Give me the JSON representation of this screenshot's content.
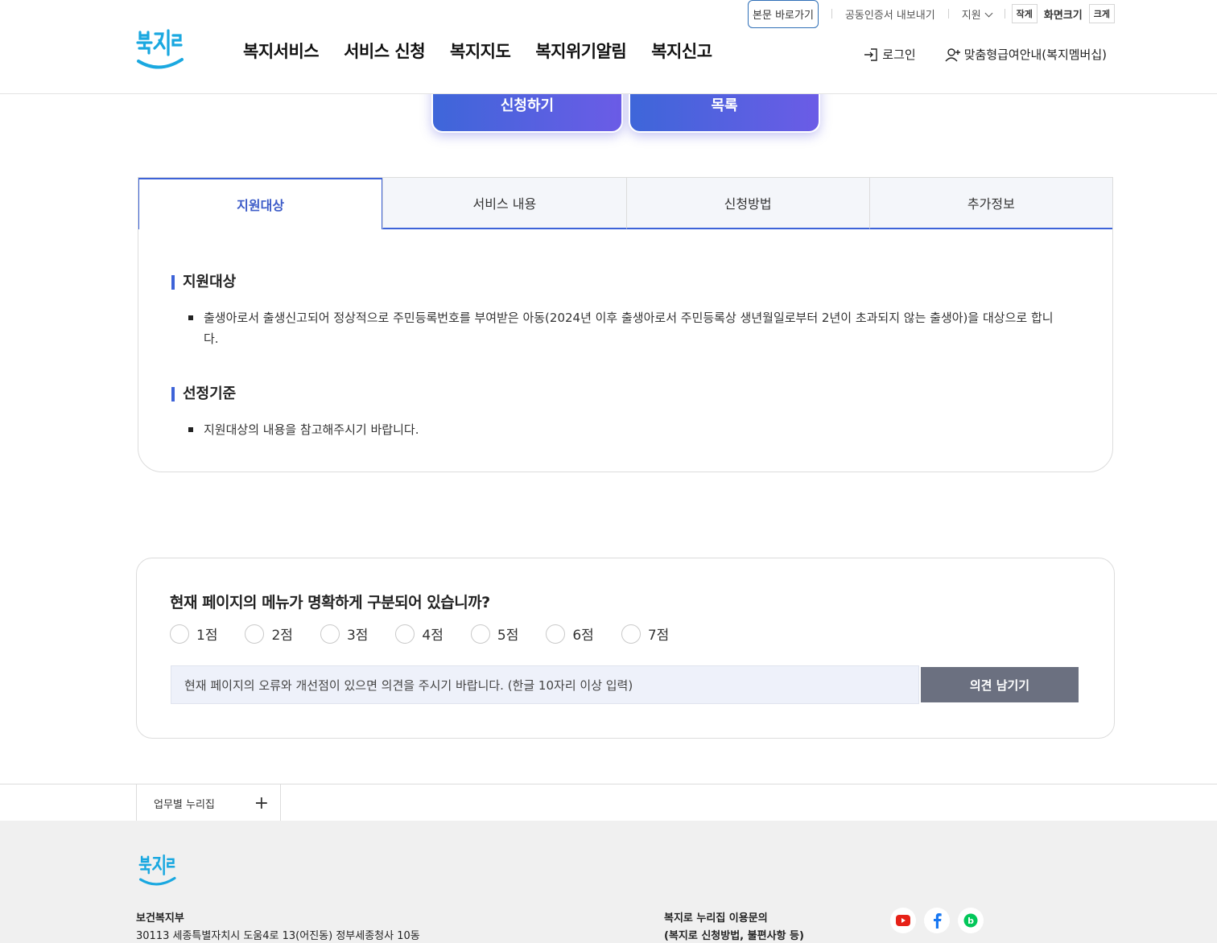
{
  "header": {
    "skip_link": "본문 바로가기",
    "util_links": [
      "공동인증서 내보내기",
      "지원"
    ],
    "font_small": "작게",
    "font_label": "화면크기",
    "font_large": "크게",
    "gnb": [
      "복지서비스",
      "서비스 신청",
      "복지지도",
      "복지위기알림",
      "복지신고"
    ],
    "login": "로그인",
    "membership": "맞춤형급여안내(복지멤버십)"
  },
  "actions": {
    "apply": "신청하기",
    "list": "목록"
  },
  "tabs": [
    "지원대상",
    "서비스 내용",
    "신청방법",
    "추가정보"
  ],
  "content": {
    "section1_title": "지원대상",
    "section1_text": "출생아로서 출생신고되어 정상적으로 주민등록번호를 부여받은 아동(2024년 이후 출생아로서 주민등록상 생년월일로부터 2년이 초과되지 않는 출생아)을 대상으로 합니다.",
    "section2_title": "선정기준",
    "section2_text": "지원대상의 내용을 참고해주시기 바랍니다."
  },
  "survey": {
    "question": "현재 페이지의 메뉴가 명확하게 구분되어 있습니까?",
    "scores": [
      "1점",
      "2점",
      "3점",
      "4점",
      "5점",
      "6점",
      "7점"
    ],
    "placeholder": "현재 페이지의 오류와 개선점이 있으면 의견을 주시기 바랍니다. (한글 10자리 이상 입력)",
    "submit": "의견 남기기"
  },
  "footer": {
    "site_select": "업무별 누리집",
    "org": "보건복지부",
    "address": "30113  세종특별자치시 도움4로 13(어진동) 정부세종청사 10동",
    "inquiry_title": "복지로 누리집 이용문의",
    "inquiry_sub": "(복지로 신청방법, 불편사항 등)"
  },
  "colors": {
    "accent": "#3d63d8",
    "gradient_start": "#3e66d9",
    "gradient_end": "#6b5ce6",
    "logo": "#1aa8e0"
  }
}
